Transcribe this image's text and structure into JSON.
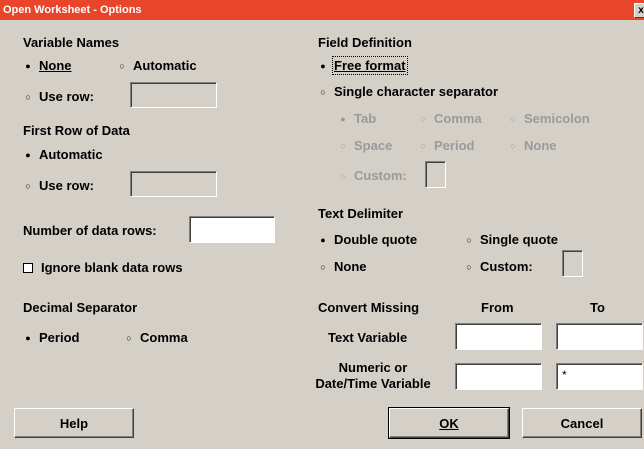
{
  "window": {
    "title": "Open Worksheet - Options",
    "close_glyph": "x"
  },
  "variable_names": {
    "heading": "Variable Names",
    "none": "None",
    "automatic": "Automatic",
    "use_row": "Use row:",
    "use_row_value": ""
  },
  "first_row": {
    "heading": "First Row of Data",
    "automatic": "Automatic",
    "use_row": "Use row:",
    "use_row_value": ""
  },
  "num_rows": {
    "label": "Number of data rows:",
    "value": ""
  },
  "ignore_blank": {
    "label": "Ignore blank data rows",
    "checked": false
  },
  "decimal": {
    "heading": "Decimal Separator",
    "period": "Period",
    "comma": "Comma"
  },
  "field_def": {
    "heading": "Field Definition",
    "free_format": "Free format",
    "single_char": "Single character separator",
    "tab": "Tab",
    "comma": "Comma",
    "semicolon": "Semicolon",
    "space": "Space",
    "period": "Period",
    "none": "None",
    "custom": "Custom:"
  },
  "text_delim": {
    "heading": "Text Delimiter",
    "double_quote": "Double quote",
    "single_quote": "Single quote",
    "none": "None",
    "custom": "Custom:"
  },
  "missing": {
    "heading": "Convert Missing",
    "from": "From",
    "to": "To",
    "text_var": "Text Variable",
    "text_from": "",
    "text_to": "",
    "numeric_line1": "Numeric or",
    "numeric_line2": "Date/Time Variable",
    "numeric_from": "",
    "numeric_to": "*"
  },
  "buttons": {
    "help": "Help",
    "ok": "OK",
    "cancel": "Cancel"
  }
}
